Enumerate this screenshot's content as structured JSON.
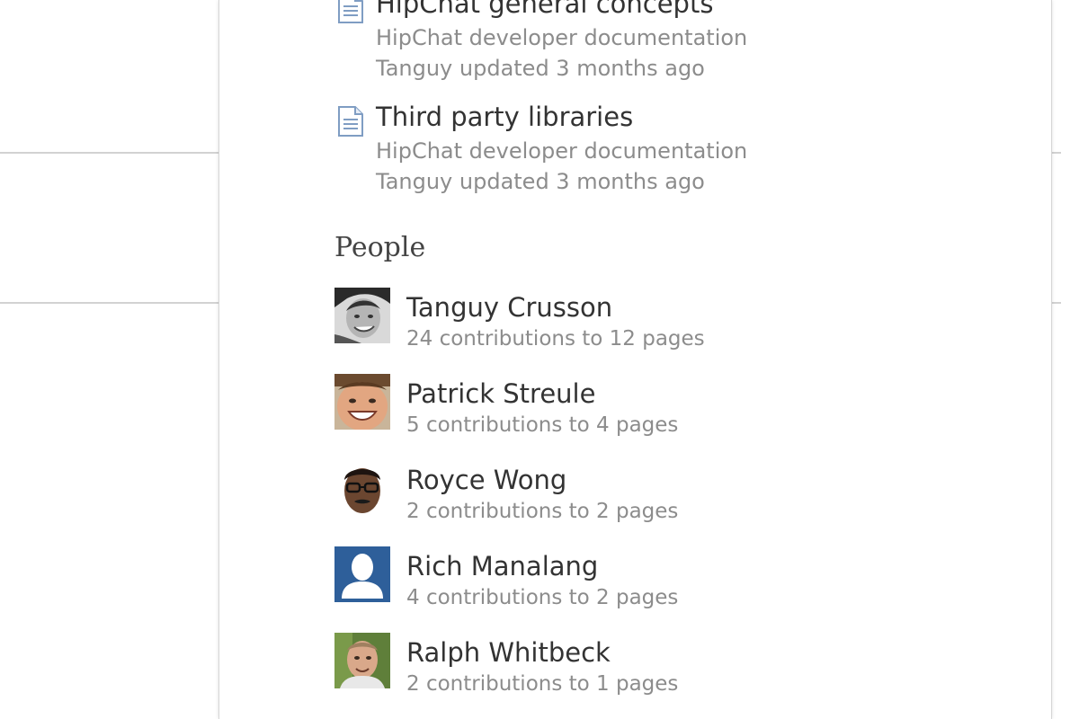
{
  "pages": [
    {
      "title": "HipChat general concepts",
      "space": "HipChat developer documentation",
      "meta": "Tanguy updated 3 months ago"
    },
    {
      "title": "Third party libraries",
      "space": "HipChat developer documentation",
      "meta": "Tanguy updated 3 months ago"
    }
  ],
  "people_heading": "People",
  "people": [
    {
      "name": "Tanguy Crusson",
      "stats": "24 contributions to 12 pages",
      "avatar_icon": "avatar-photo-bw"
    },
    {
      "name": "Patrick Streule",
      "stats": "5 contributions to 4 pages",
      "avatar_icon": "avatar-photo-smiling"
    },
    {
      "name": "Royce Wong",
      "stats": "2 contributions to 2 pages",
      "avatar_icon": "avatar-cartoon-glasses"
    },
    {
      "name": "Rich Manalang",
      "stats": "4 contributions to 2 pages",
      "avatar_icon": "default-user-avatar"
    },
    {
      "name": "Ralph Whitbeck",
      "stats": "2 contributions to 1 pages",
      "avatar_icon": "avatar-photo-outdoor"
    }
  ],
  "colors": {
    "title_text": "#333333",
    "secondary_text": "#8c8c8c",
    "default_avatar_bg": "#2e5f9a"
  }
}
